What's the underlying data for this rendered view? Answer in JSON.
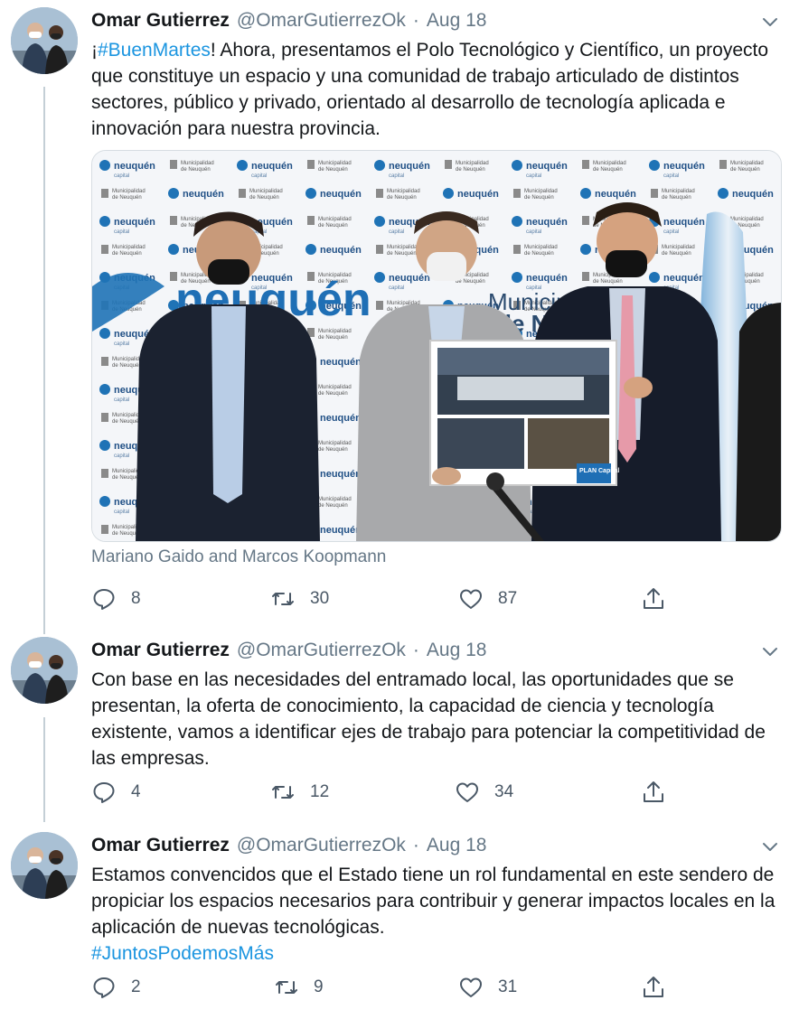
{
  "tweets": [
    {
      "name": "Omar Gutierrez",
      "handle": "@OmarGutierrezOk",
      "separator": "·",
      "date": "Aug 18",
      "text_pre": "¡",
      "hashtag": "#BuenMartes",
      "text_post": "! Ahora, presentamos el Polo Tecnológico y Científico, un proyecto que constituye un espacio y una comunidad de trabajo articulado de distintos sectores, público y privado, orientado al desarrollo de tecnología aplicada e innovación para nuestra provincia.",
      "photo": {
        "brand_small": "neuquén",
        "brand_small_sub": "capital",
        "brand_large": "neuquén",
        "municipality": "Municipalidad de Neuquén",
        "muni_large": "Municipalidad",
        "muni_large2": "de Neuquén",
        "board_label": "PLAN Capital"
      },
      "caption": "Mariano Gaido and Marcos Koopmann",
      "replies": "8",
      "retweets": "30",
      "likes": "87"
    },
    {
      "name": "Omar Gutierrez",
      "handle": "@OmarGutierrezOk",
      "separator": "·",
      "date": "Aug 18",
      "text": "Con base en las necesidades del entramado local, las oportunidades que se presentan, la oferta de conocimiento, la capacidad de ciencia y tecnología existente, vamos a identificar ejes de trabajo para potenciar la competitividad de las empresas.",
      "replies": "4",
      "retweets": "12",
      "likes": "34"
    },
    {
      "name": "Omar Gutierrez",
      "handle": "@OmarGutierrezOk",
      "separator": "·",
      "date": "Aug 18",
      "text": "Estamos convencidos que el Estado tiene un rol fundamental en este sendero de propiciar los espacios necesarios para contribuir y generar impactos locales en la aplicación de nuevas tecnológicas.",
      "hashtag": "#JuntosPodemosMás",
      "replies": "2",
      "retweets": "9",
      "likes": "31"
    }
  ],
  "icons": {
    "reply": "reply-icon",
    "retweet": "retweet-icon",
    "like": "heart-icon",
    "share": "share-icon",
    "more": "chevron-down-icon"
  },
  "colors": {
    "link": "#1b95e0",
    "secondary": "#657786",
    "thread_line": "#c4cfd6"
  }
}
